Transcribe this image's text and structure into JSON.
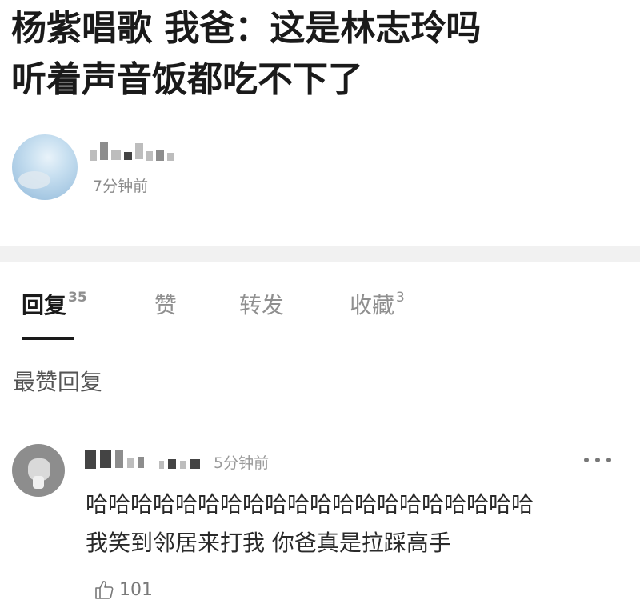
{
  "post": {
    "title_line1": "杨紫唱歌 我爸：这是林志玲吗",
    "title_line2": "听着声音饭都吃不下了",
    "author_time": "7分钟前"
  },
  "tabs": [
    {
      "label": "回复",
      "count": "35"
    },
    {
      "label": "赞",
      "count": ""
    },
    {
      "label": "转发",
      "count": ""
    },
    {
      "label": "收藏",
      "count": "3"
    }
  ],
  "section_title": "最赞回复",
  "comment": {
    "time": "5分钟前",
    "line1": "哈哈哈哈哈哈哈哈哈哈哈哈哈哈哈哈哈哈哈哈",
    "line2": "我笑到邻居来打我 你爸真是拉踩高手",
    "likes": "101"
  },
  "icons": {
    "more": "more-icon",
    "like": "thumb-up-icon"
  }
}
